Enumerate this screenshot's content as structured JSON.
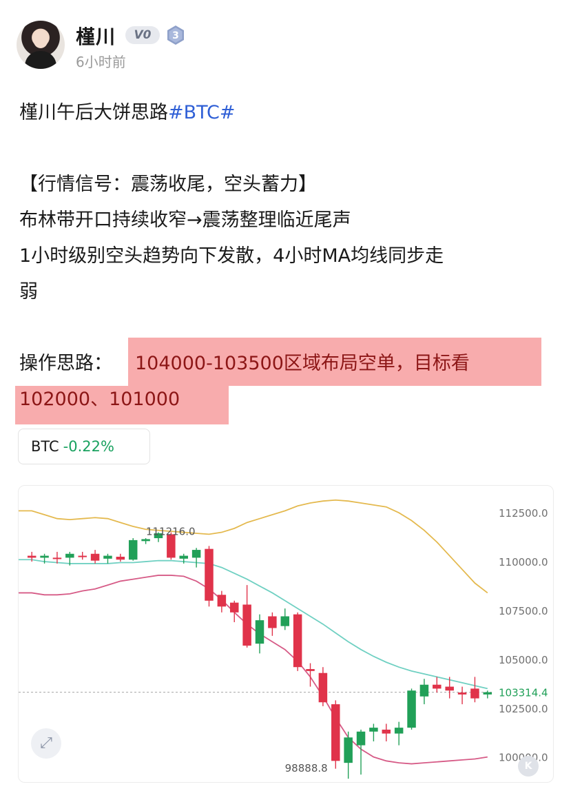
{
  "user": {
    "name": "槿川",
    "vip_badge": "V0",
    "level_badge": "3",
    "time": "6小时前"
  },
  "post": {
    "title_prefix": "槿川午后大饼思路",
    "hashtag": "#BTC#",
    "signal": "【行情信号：震荡收尾，空头蓄力】",
    "line1": "布林带开口持续收窄→震荡整理临近尾声",
    "line2a": "1小时级别空头趋势向下发散，4小时MA均线同步走",
    "line2b": "弱",
    "plan_label": "操作思路：",
    "plan_hl1": "104000-103500区域布局空单，目标看",
    "plan_hl2": "102000、101000"
  },
  "ticker": {
    "symbol": "BTC",
    "change": "-0.22%",
    "change_color": "#19a15f"
  },
  "chart_data": {
    "type": "candlestick",
    "y_axis_labels": [
      "112500.0",
      "110000.0",
      "107500.0",
      "105000.0",
      "103314.4",
      "102500.0",
      "100000.0"
    ],
    "ylim": [
      99000,
      113600
    ],
    "high_label": "111216.0",
    "low_label": "98888.8",
    "current_price": 103314.4,
    "up_color": "#21a058",
    "down_color": "#e0334a",
    "candles": [
      {
        "o": 110300,
        "h": 110500,
        "l": 110000,
        "c": 110200
      },
      {
        "o": 110200,
        "h": 110400,
        "l": 109900,
        "c": 110300
      },
      {
        "o": 110200,
        "h": 110500,
        "l": 109900,
        "c": 110150
      },
      {
        "o": 110200,
        "h": 110500,
        "l": 109800,
        "c": 110400
      },
      {
        "o": 110300,
        "h": 110500,
        "l": 110100,
        "c": 110250
      },
      {
        "o": 110400,
        "h": 110600,
        "l": 109900,
        "c": 110050
      },
      {
        "o": 110150,
        "h": 110400,
        "l": 109900,
        "c": 110300
      },
      {
        "o": 110250,
        "h": 110400,
        "l": 110000,
        "c": 110100
      },
      {
        "o": 110100,
        "h": 111200,
        "l": 110050,
        "c": 111100
      },
      {
        "o": 111050,
        "h": 111200,
        "l": 110900,
        "c": 111150
      },
      {
        "o": 111200,
        "h": 111500,
        "l": 111000,
        "c": 111450
      },
      {
        "o": 111400,
        "h": 111500,
        "l": 110100,
        "c": 110200
      },
      {
        "o": 110150,
        "h": 110400,
        "l": 109900,
        "c": 110300
      },
      {
        "o": 110200,
        "h": 110700,
        "l": 109700,
        "c": 110600
      },
      {
        "o": 110650,
        "h": 110800,
        "l": 107700,
        "c": 108000
      },
      {
        "o": 108300,
        "h": 108500,
        "l": 107400,
        "c": 107700
      },
      {
        "o": 107900,
        "h": 108000,
        "l": 106900,
        "c": 107400
      },
      {
        "o": 107800,
        "h": 108800,
        "l": 105600,
        "c": 105700
      },
      {
        "o": 105800,
        "h": 107300,
        "l": 105300,
        "c": 107000
      },
      {
        "o": 107200,
        "h": 107400,
        "l": 106200,
        "c": 106600
      },
      {
        "o": 106700,
        "h": 107600,
        "l": 106500,
        "c": 107200
      },
      {
        "o": 107300,
        "h": 107400,
        "l": 104400,
        "c": 104600
      },
      {
        "o": 104500,
        "h": 104800,
        "l": 103600,
        "c": 104400
      },
      {
        "o": 104300,
        "h": 104600,
        "l": 102600,
        "c": 102800
      },
      {
        "o": 102700,
        "h": 102900,
        "l": 99400,
        "c": 99800
      },
      {
        "o": 99700,
        "h": 101300,
        "l": 98888.8,
        "c": 101000
      },
      {
        "o": 100600,
        "h": 101400,
        "l": 99100,
        "c": 101300
      },
      {
        "o": 101300,
        "h": 101700,
        "l": 100800,
        "c": 101500
      },
      {
        "o": 101400,
        "h": 101700,
        "l": 100800,
        "c": 101200
      },
      {
        "o": 101200,
        "h": 101800,
        "l": 100600,
        "c": 101500
      },
      {
        "o": 101500,
        "h": 103500,
        "l": 101400,
        "c": 103400
      },
      {
        "o": 103100,
        "h": 104000,
        "l": 102700,
        "c": 103700
      },
      {
        "o": 103700,
        "h": 104100,
        "l": 103300,
        "c": 103500
      },
      {
        "o": 103600,
        "h": 104100,
        "l": 103000,
        "c": 103400
      },
      {
        "o": 103300,
        "h": 103600,
        "l": 102700,
        "c": 103200
      },
      {
        "o": 103500,
        "h": 104100,
        "l": 102800,
        "c": 103000
      },
      {
        "o": 103200,
        "h": 103400,
        "l": 103000,
        "c": 103314.4
      }
    ],
    "bollinger_upper": [
      112600,
      112400,
      112200,
      112150,
      112200,
      112250,
      112200,
      112000,
      111800,
      111650,
      111600,
      111550,
      111500,
      111450,
      111400,
      111500,
      111700,
      112000,
      112200,
      112400,
      112600,
      112850,
      113000,
      113100,
      113150,
      113100,
      113000,
      112900,
      112800,
      112500,
      112100,
      111600,
      111000,
      110300,
      109600,
      108900,
      108400
    ],
    "bollinger_middle": [
      110100,
      110000,
      109950,
      109900,
      109900,
      109900,
      109900,
      109950,
      109950,
      110000,
      110050,
      110050,
      110000,
      109950,
      109900,
      109700,
      109400,
      109100,
      108750,
      108400,
      108000,
      107600,
      107200,
      106800,
      106350,
      105900,
      105500,
      105150,
      104850,
      104600,
      104400,
      104250,
      104100,
      103950,
      103800,
      103650,
      103500
    ],
    "bollinger_lower": [
      108400,
      108300,
      108300,
      108350,
      108500,
      108600,
      108800,
      109000,
      109100,
      109200,
      109300,
      109300,
      109250,
      109000,
      108600,
      108050,
      107400,
      106800,
      106300,
      105900,
      105500,
      104900,
      104100,
      103100,
      102000,
      101000,
      100400,
      100000,
      99800,
      99700,
      99650,
      99700,
      99750,
      99800,
      99850,
      99900,
      100000
    ]
  },
  "buttons": {
    "close": "K"
  }
}
